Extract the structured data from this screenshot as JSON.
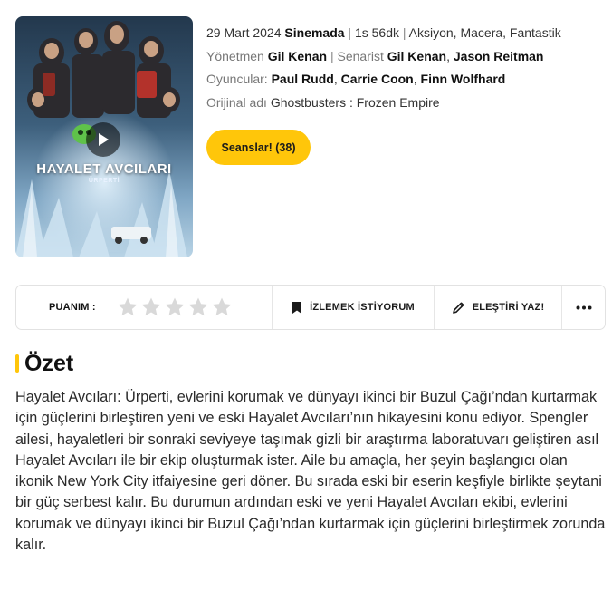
{
  "poster": {
    "title": "HAYALET AVCILARI",
    "subtitle": "ÜRPERTİ",
    "play_icon": "play-icon"
  },
  "info": {
    "date": "29 Mart 2024",
    "status": "Sinemada",
    "duration": "1s 56dk",
    "genres": "Aksiyon, Macera, Fantastik",
    "director_label": "Yönetmen",
    "director": "Gil Kenan",
    "writer_label": "Senarist",
    "writers": [
      "Gil Kenan",
      "Jason Reitman"
    ],
    "cast_label": "Oyuncular:",
    "cast": [
      "Paul Rudd",
      "Carrie Coon",
      "Finn Wolfhard"
    ],
    "original_title_label": "Orijinal adı",
    "original_title": "Ghostbusters : Frozen Empire"
  },
  "sessions_button": "Seanslar! (38)",
  "action_bar": {
    "rating_label": "PUANIM :",
    "star_count": 5,
    "rating_value": 0,
    "watchlist_label": "İZLEMEK İSTİYORUM",
    "watchlist_icon": "bookmark-icon",
    "review_label": "ELEŞTİRİ YAZ!",
    "review_icon": "pencil-icon",
    "more_icon": "more-dots-icon"
  },
  "summary": {
    "title": "Özet",
    "text": "Hayalet Avcıları: Ürperti, evlerini korumak ve dünyayı ikinci bir Buzul Çağı’ndan kurtarmak için güçlerini birleştiren yeni ve eski Hayalet Avcıları’nın hikayesini konu ediyor. Spengler ailesi, hayaletleri bir sonraki seviyeye taşımak gizli bir araştırma laboratuvarı geliştiren asıl Hayalet Avcıları ile bir ekip oluşturmak ister. Aile bu amaçla, her şeyin başlangıcı olan ikonik New York City itfaiyesine geri döner. Bu sırada eski bir eserin keşfiyle birlikte şeytani bir güç serbest kalır. Bu durumun ardından eski ve yeni Hayalet Avcıları ekibi, evlerini korumak ve dünyayı ikinci bir Buzul Çağı’ndan kurtarmak için güçlerini birleştirmek zorunda kalır."
  },
  "colors": {
    "accent": "#ffc60a",
    "star_empty": "#d9d9d9",
    "border": "#e2e2e2"
  }
}
